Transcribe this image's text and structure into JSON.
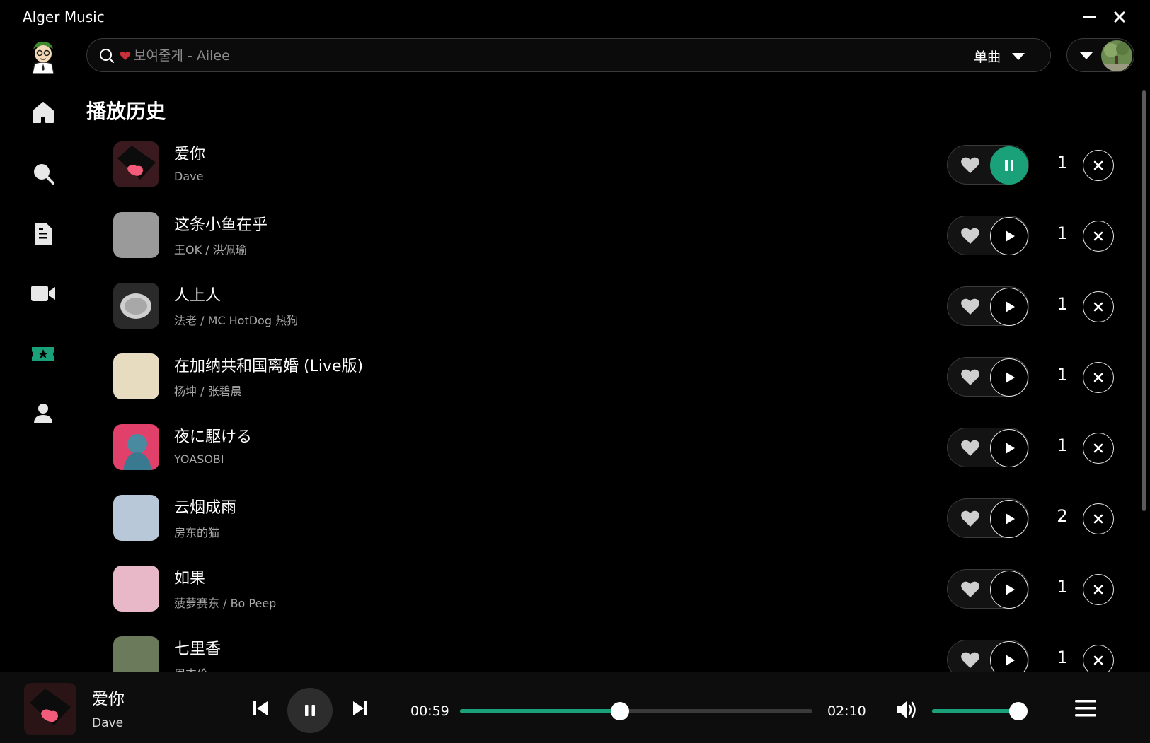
{
  "app": {
    "title": "Alger Music"
  },
  "window": {
    "minimize_icon": "minimize-icon",
    "close_icon": "close-icon"
  },
  "search": {
    "placeholder": "보여줄게 - Ailee",
    "type_label": "单曲"
  },
  "sidebar": {
    "items": [
      {
        "name": "home",
        "icon": "home-icon",
        "active": false
      },
      {
        "name": "search",
        "icon": "search-icon",
        "active": false
      },
      {
        "name": "playlist",
        "icon": "document-icon",
        "active": false
      },
      {
        "name": "mv",
        "icon": "video-icon",
        "active": false
      },
      {
        "name": "history",
        "icon": "ticket-star-icon",
        "active": true
      },
      {
        "name": "user",
        "icon": "user-icon",
        "active": false
      }
    ]
  },
  "page": {
    "title": "播放历史"
  },
  "history": [
    {
      "name": "爱你",
      "artist": "Dave",
      "count": "1",
      "playing": true,
      "cover": "#3a1a1f"
    },
    {
      "name": "这条小鱼在乎",
      "artist": "王OK / 洪佩瑜",
      "count": "1",
      "playing": false,
      "cover": "#9a9a9a"
    },
    {
      "name": "人上人",
      "artist": "法老 / MC HotDog 热狗",
      "count": "1",
      "playing": false,
      "cover": "#2a2a2a"
    },
    {
      "name": "在加纳共和国离婚 (Live版)",
      "artist": "杨坤 / 张碧晨",
      "count": "1",
      "playing": false,
      "cover": "#e8dcc0"
    },
    {
      "name": "夜に駆ける",
      "artist": "YOASOBI",
      "count": "1",
      "playing": false,
      "cover": "#e0406a"
    },
    {
      "name": "云烟成雨",
      "artist": "房东的猫",
      "count": "2",
      "playing": false,
      "cover": "#b8c8d8"
    },
    {
      "name": "如果",
      "artist": "菠萝赛东 / Bo Peep",
      "count": "1",
      "playing": false,
      "cover": "#e8b8c8"
    },
    {
      "name": "七里香",
      "artist": "周杰伦",
      "count": "1",
      "playing": false,
      "cover": "#6a7a5a"
    }
  ],
  "player": {
    "title": "爱你",
    "artist": "Dave",
    "time_current": "00:59",
    "time_total": "02:10",
    "progress_fraction": 0.454,
    "volume_fraction": 1.0
  },
  "colors": {
    "accent": "#1aa179",
    "background": "#000000"
  }
}
